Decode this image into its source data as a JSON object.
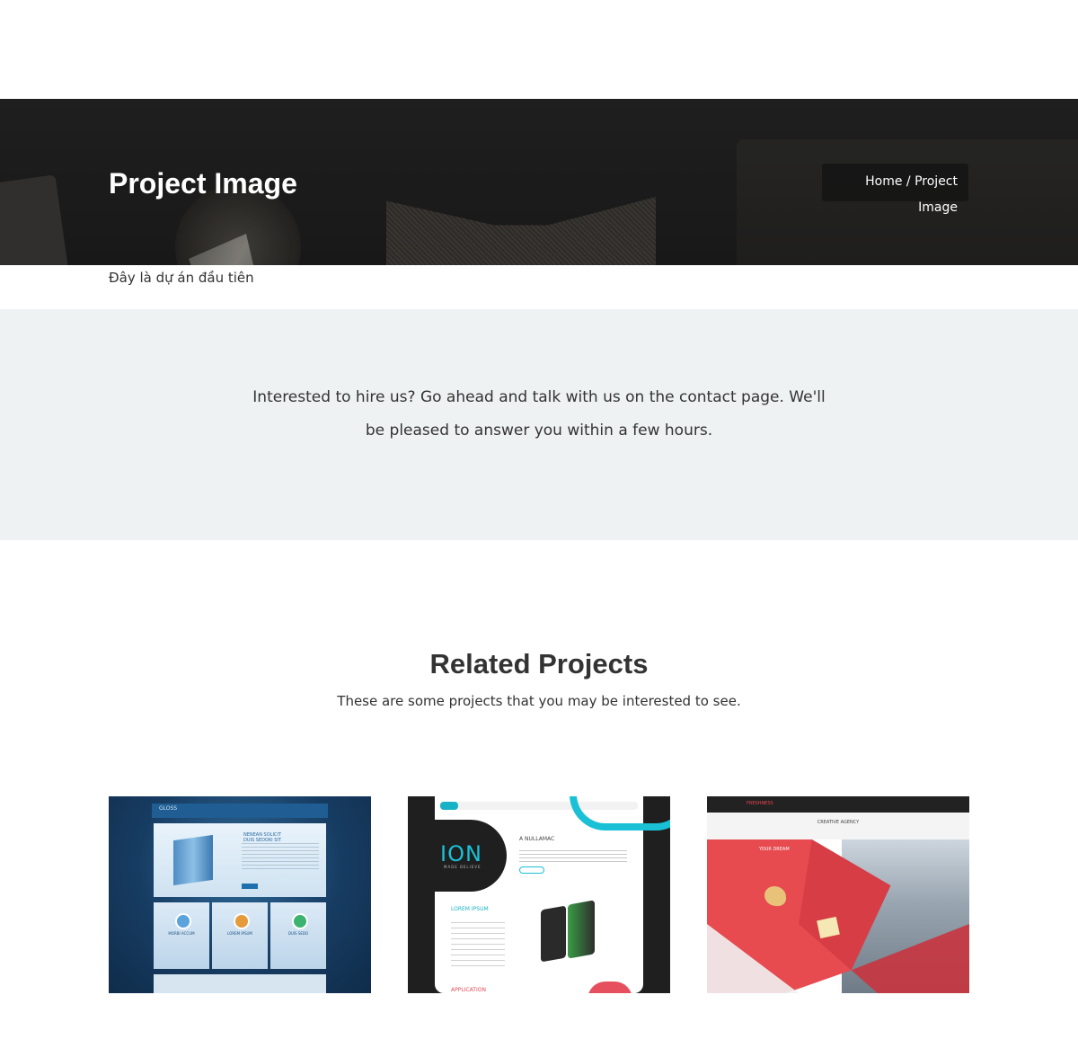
{
  "hero": {
    "title": "Project Image",
    "breadcrumb": {
      "home": "Home",
      "separator": " / ",
      "current": "Project Image"
    }
  },
  "intro": {
    "text": "Đây là dự án đầu tiên"
  },
  "cta": {
    "text": "Interested to hire us? Go ahead and talk with us on the contact page. We'll be pleased to answer you within a few hours."
  },
  "related": {
    "title": "Related Projects",
    "subtitle": "These are some projects that you may be interested to see."
  },
  "colors": {
    "cta_band": "#eff2f3",
    "hero_dark": "#262626",
    "accent_teal": "#1ac1d6",
    "accent_red": "#e74a4f"
  }
}
